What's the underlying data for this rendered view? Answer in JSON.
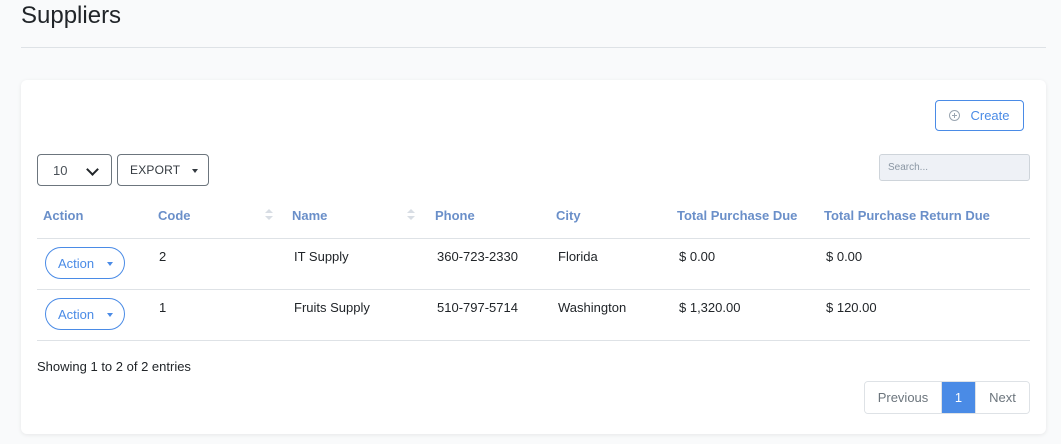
{
  "page": {
    "title": "Suppliers"
  },
  "toolbar": {
    "create_label": "Create",
    "page_length": "10",
    "export_label": "EXPORT",
    "search_placeholder": "Search..."
  },
  "table": {
    "columns": [
      "Action",
      "Code",
      "Name",
      "Phone",
      "City",
      "Total Purchase Due",
      "Total Purchase Return Due"
    ],
    "rows": [
      {
        "action": "Action",
        "code": "2",
        "name": "IT Supply",
        "phone": "360-723-2330",
        "city": "Florida",
        "total_purchase_due": "$ 0.00",
        "total_purchase_return_due": "$ 0.00"
      },
      {
        "action": "Action",
        "code": "1",
        "name": "Fruits Supply",
        "phone": "510-797-5714",
        "city": "Washington",
        "total_purchase_due": "$ 1,320.00",
        "total_purchase_return_due": "$ 120.00"
      }
    ]
  },
  "footer": {
    "info": "Showing 1 to 2 of 2 entries",
    "pagination": {
      "previous": "Previous",
      "current": "1",
      "next": "Next"
    }
  },
  "colors": {
    "accent": "#4a8be6",
    "header_text": "#6a8fc9"
  }
}
